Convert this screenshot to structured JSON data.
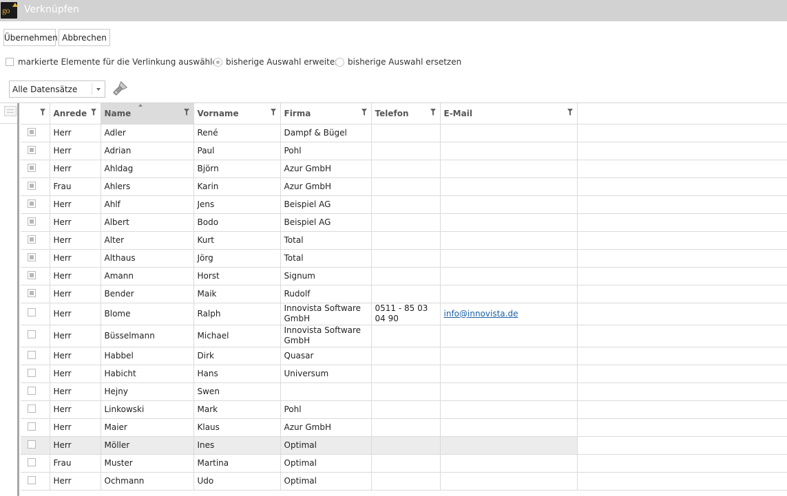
{
  "window": {
    "title": "Verknüpfen",
    "logo_text": "go"
  },
  "toolbar": {
    "apply_label": "Übernehmen",
    "cancel_label": "Abbrechen"
  },
  "options": {
    "select_marked_label": "markierte Elemente für die Verlinkung auswählen",
    "select_marked_checked": false,
    "extend_label": "bisherige Auswahl erweitern",
    "replace_label": "bisherige Auswahl ersetzen",
    "selected_mode": "extend"
  },
  "filter": {
    "dataset_value": "Alle Datensätze",
    "search_icon": "flashlight-icon"
  },
  "grid": {
    "columns": [
      "Anrede",
      "Name",
      "Vorname",
      "Firma",
      "Telefon",
      "E-Mail"
    ],
    "sorted_column": "Name",
    "rows": [
      {
        "checked": true,
        "anrede": "Herr",
        "name": "Adler",
        "vorname": "René",
        "firma": "Dampf & Bügel",
        "telefon": "",
        "email": ""
      },
      {
        "checked": true,
        "anrede": "Herr",
        "name": "Adrian",
        "vorname": "Paul",
        "firma": "Pohl",
        "telefon": "",
        "email": ""
      },
      {
        "checked": true,
        "anrede": "Herr",
        "name": "Ahldag",
        "vorname": "Björn",
        "firma": "Azur GmbH",
        "telefon": "",
        "email": ""
      },
      {
        "checked": true,
        "anrede": "Frau",
        "name": "Ahlers",
        "vorname": "Karin",
        "firma": "Azur GmbH",
        "telefon": "",
        "email": ""
      },
      {
        "checked": true,
        "anrede": "Herr",
        "name": "Ahlf",
        "vorname": "Jens",
        "firma": "Beispiel AG",
        "telefon": "",
        "email": ""
      },
      {
        "checked": true,
        "anrede": "Herr",
        "name": "Albert",
        "vorname": "Bodo",
        "firma": "Beispiel AG",
        "telefon": "",
        "email": ""
      },
      {
        "checked": true,
        "anrede": "Herr",
        "name": "Alter",
        "vorname": "Kurt",
        "firma": "Total",
        "telefon": "",
        "email": ""
      },
      {
        "checked": true,
        "anrede": "Herr",
        "name": "Althaus",
        "vorname": "Jörg",
        "firma": "Total",
        "telefon": "",
        "email": ""
      },
      {
        "checked": true,
        "anrede": "Herr",
        "name": "Amann",
        "vorname": "Horst",
        "firma": "Signum",
        "telefon": "",
        "email": ""
      },
      {
        "checked": true,
        "anrede": "Herr",
        "name": "Bender",
        "vorname": "Maik",
        "firma": "Rudolf",
        "telefon": "",
        "email": ""
      },
      {
        "checked": false,
        "anrede": "Herr",
        "name": "Blome",
        "vorname": "Ralph",
        "firma": "Innovista Software GmbH",
        "telefon": "0511 - 85 03 04 90",
        "email": "info@innovista.de"
      },
      {
        "checked": false,
        "anrede": "Herr",
        "name": "Büsselmann",
        "vorname": "Michael",
        "firma": "Innovista Software GmbH",
        "telefon": "",
        "email": ""
      },
      {
        "checked": false,
        "anrede": "Herr",
        "name": "Habbel",
        "vorname": "Dirk",
        "firma": "Quasar",
        "telefon": "",
        "email": ""
      },
      {
        "checked": false,
        "anrede": "Herr",
        "name": "Habicht",
        "vorname": "Hans",
        "firma": "Universum",
        "telefon": "",
        "email": ""
      },
      {
        "checked": false,
        "anrede": "Herr",
        "name": "Hejny",
        "vorname": "Swen",
        "firma": "",
        "telefon": "",
        "email": ""
      },
      {
        "checked": false,
        "anrede": "Herr",
        "name": "Linkowski",
        "vorname": "Mark",
        "firma": "Pohl",
        "telefon": "",
        "email": ""
      },
      {
        "checked": false,
        "anrede": "Herr",
        "name": "Maier",
        "vorname": "Klaus",
        "firma": "Azur GmbH",
        "telefon": "",
        "email": ""
      },
      {
        "checked": false,
        "anrede": "Herr",
        "name": "Möller",
        "vorname": "Ines",
        "firma": "Optimal",
        "telefon": "",
        "email": ""
      },
      {
        "checked": false,
        "anrede": "Frau",
        "name": "Muster",
        "vorname": "Martina",
        "firma": "Optimal",
        "telefon": "",
        "email": ""
      },
      {
        "checked": false,
        "anrede": "Herr",
        "name": "Ochmann",
        "vorname": "Udo",
        "firma": "Optimal",
        "telefon": "",
        "email": ""
      }
    ],
    "highlighted_row_name": "Möller"
  },
  "colors": {
    "titlebar": "#d2d2d2",
    "sorted_header": "#dcdcdc",
    "link": "#1a5fa6",
    "highlight_row": "#ececec"
  }
}
